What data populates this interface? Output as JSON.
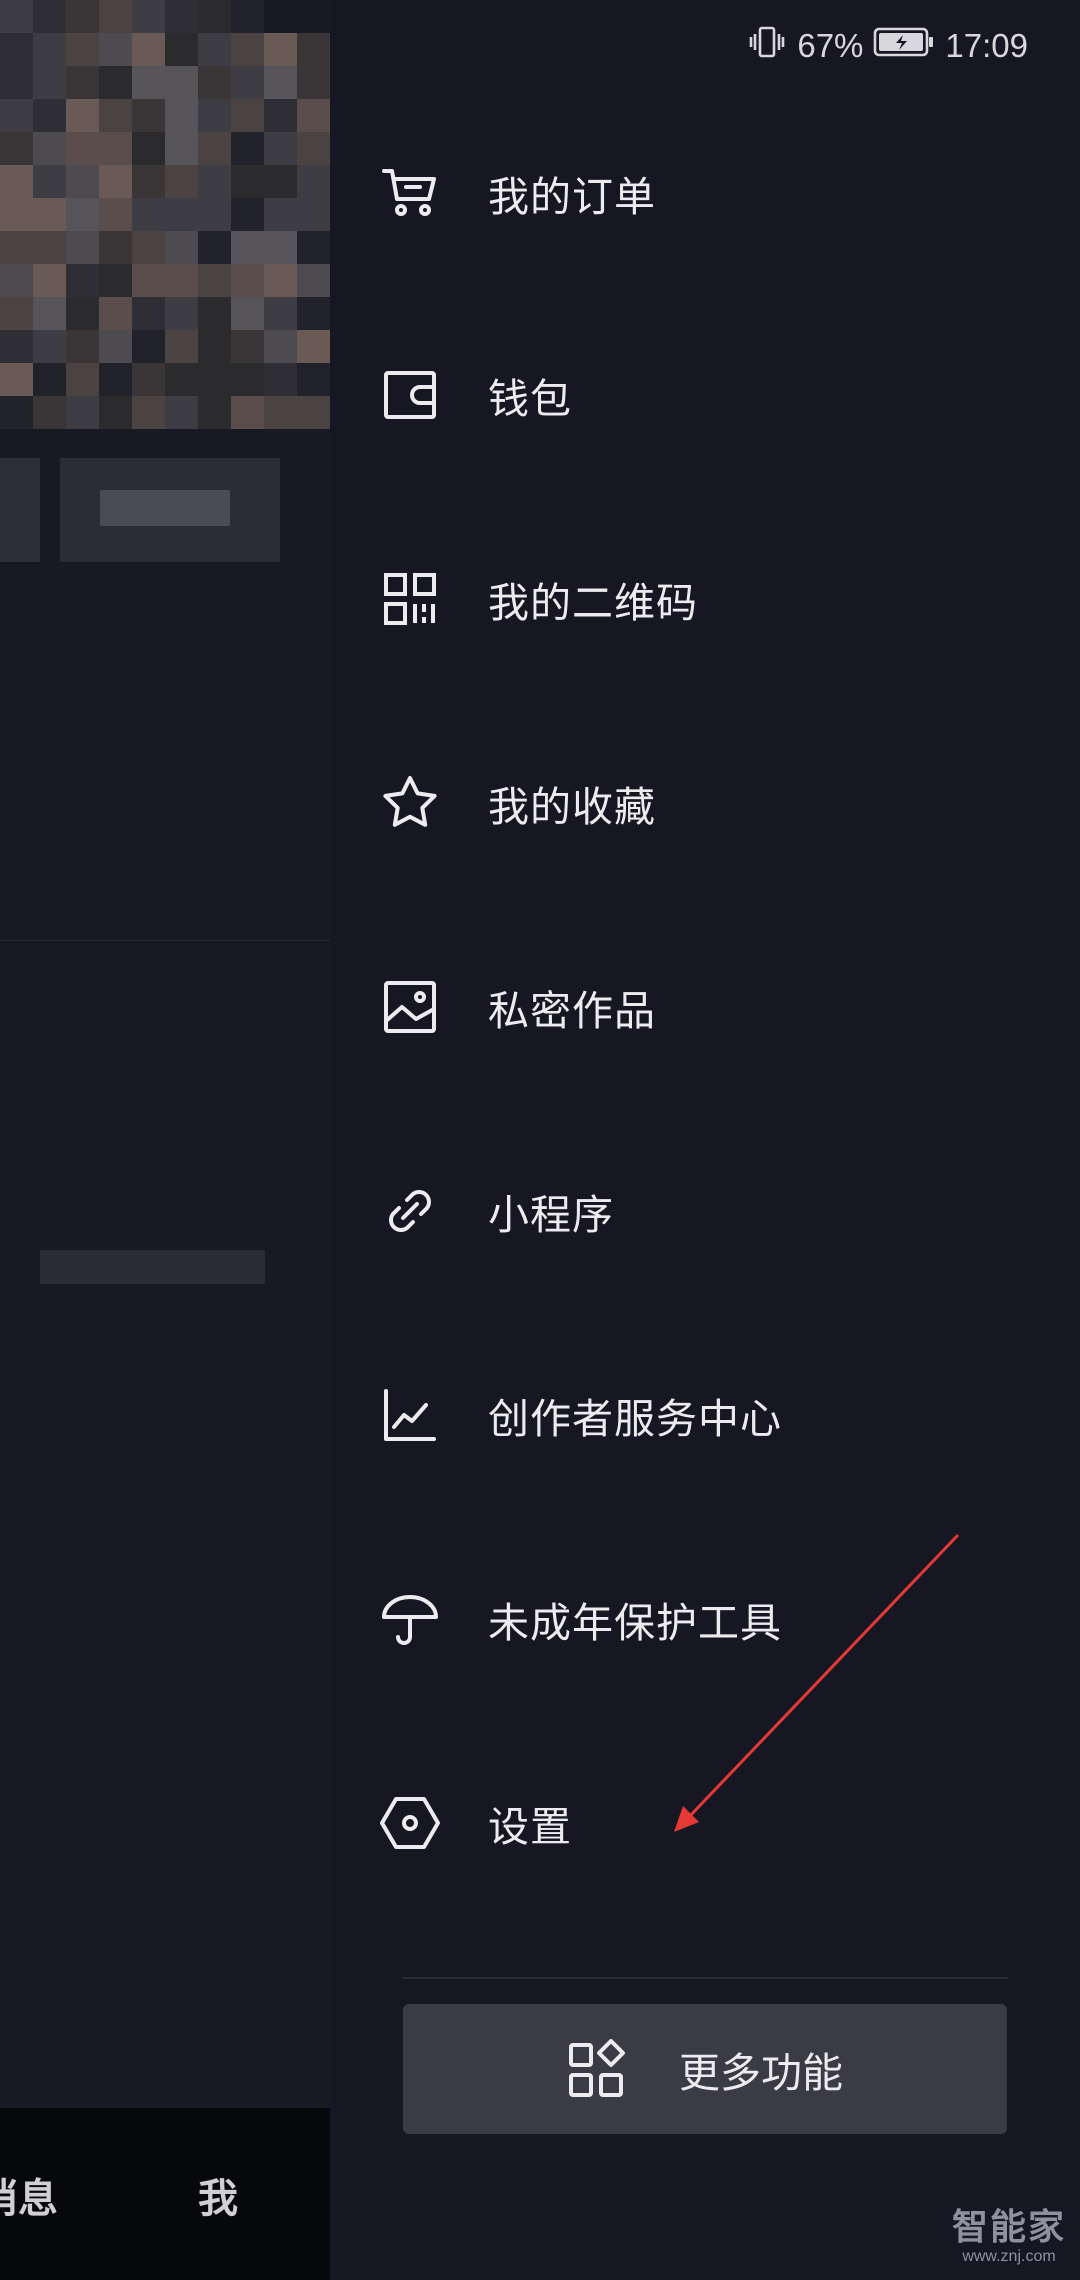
{
  "status_bar": {
    "battery_percent": "67%",
    "time": "17:09",
    "icons": [
      "vibrate-icon",
      "battery-charging-icon"
    ]
  },
  "drawer": {
    "items": [
      {
        "label": "我的订单",
        "icon": "cart-icon"
      },
      {
        "label": "钱包",
        "icon": "wallet-icon"
      },
      {
        "label": "我的二维码",
        "icon": "qr-code-icon"
      },
      {
        "label": "我的收藏",
        "icon": "star-icon"
      },
      {
        "label": "私密作品",
        "icon": "image-icon"
      },
      {
        "label": "小程序",
        "icon": "link-icon"
      },
      {
        "label": "创作者服务中心",
        "icon": "chart-icon"
      },
      {
        "label": "未成年保护工具",
        "icon": "umbrella-icon"
      },
      {
        "label": "设置",
        "icon": "hexagon-settings-icon"
      }
    ],
    "more_button": {
      "label": "更多功能",
      "icon": "grid-apps-icon"
    }
  },
  "background": {
    "bottom_tabs": [
      {
        "label": "消息"
      },
      {
        "label": "我"
      }
    ]
  },
  "annotation": {
    "arrow_color": "#e53935"
  },
  "watermark": {
    "main": "智能家",
    "sub": "www.znj.com"
  },
  "colors": {
    "drawer_bg": "#161722",
    "button_bg": "#3a3b45",
    "text": "#ececf0"
  }
}
